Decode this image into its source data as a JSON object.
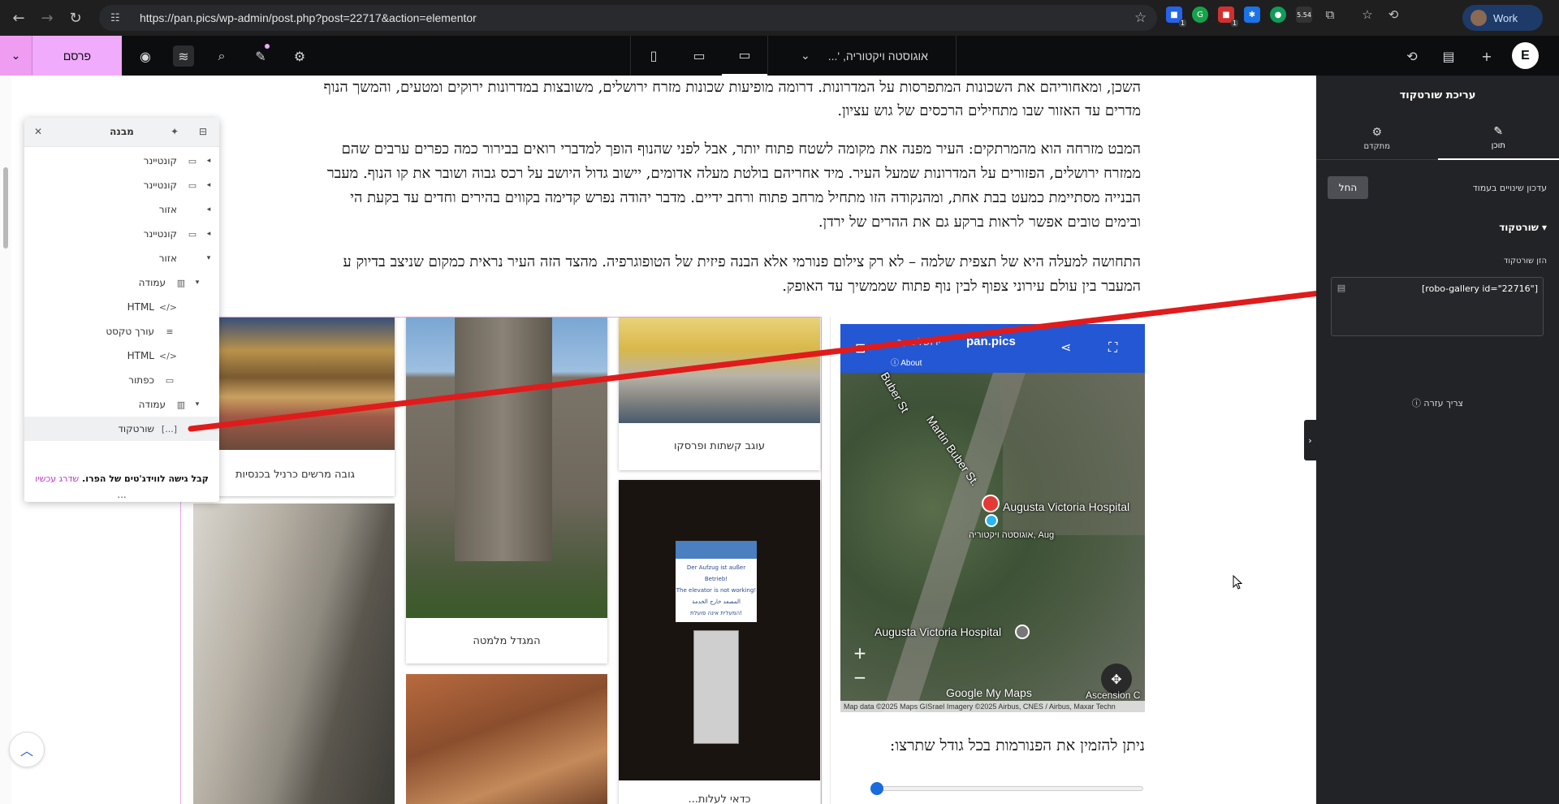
{
  "browser": {
    "url": "https://pan.pics/wp-admin/post.php?post=22717&action=elementor",
    "profile_label": "Work",
    "ext_badge_count": "5.54"
  },
  "topbar": {
    "publish_label": "פרסם",
    "document_title": "אוגוסטה ויקטוריה, '..."
  },
  "content": {
    "paragraphs": [
      "השכן, ומאחוריהם את השכונות המתפרסות על המדרונות. דרומה מופיעות שכונות מזרח ירושלים, משובצות במדרונות ירוקים ומטעים, והמשך הנוף",
      "מדרים עד האזור שבו מתחילים הרכסים של גוש עציון.",
      "המבט מזרחה הוא מהמרתקים: העיר מפנה את מקומה לשטח פתוח יותר, אבל לפני שהנוף הופך למדברי רואים בבירור כמה כפרים ערבים שהם",
      "ממזרח ירושלים, הפזורים על המדרונות שמעל העיר. מיד אחריהם בולטת מעלה אדומים, יישוב גדול היושב על רכס גבוה ושובר את קו הנוף. מעבר",
      "הבנייה מסתיימת כמעט בבת אחת, ומהנקודה הזו מתחיל מרחב פתוח ורחב ידיים. מדבר יהודה נפרש קדימה בקווים בהירים וחדים עד בקעת הי",
      "ובימים טובים אפשר לראות ברקע גם את ההרים של ירדן.",
      "התחושה למעלה היא של תצפית שלמה – לא רק צילום פנורמי אלא הבנה פיזית של הטופוגרפיה. מהצד הזה העיר נראית כמקום שניצב בדיוק ע",
      "המעבר בין עולם עירוני צפוף לבין נוף פתוח שממשיך עד האופק."
    ],
    "gallery_captions": [
      "גובה מרשים כרניל בכנסיות",
      "המגדל מלמטה",
      "עוגב קשתות ופרסקו",
      "כדאי לעלות..."
    ],
    "elevator_sign": {
      "german": "Der Aufzug ist außer Betrieb!",
      "english": "The elevator is not working!",
      "arabic": "المصعد خارج الخدمة",
      "hebrew": "המעלית אינה פועלת!"
    },
    "map": {
      "place_name": "pan.pics",
      "header_prefix": "ירושלים ,ב",
      "about_label": "About",
      "street_labels": [
        "Buber St",
        "Martin Buber St."
      ],
      "poi_hospital_label": "Augusta Victoria Hospital",
      "poi_hebrew_label": "אוגוסטה ויקטוריה, Aug",
      "poi_hospital_label_2": "Augusta Victoria Hospital",
      "poi_ascension": "Ascension C",
      "google_label": "Google My Maps",
      "attribution": "Map data ©2025 Maps GISrael Imagery ©2025 Airbus, CNES / Airbus, Maxar Techn",
      "zoom_in": "+",
      "zoom_out": "−"
    },
    "order_text": "ניתן להזמין את הפנורמות בכל גודל שתרצו:",
    "slider_position": 0
  },
  "navigator": {
    "title": "מבנה",
    "items": [
      {
        "label": "קונטיינר",
        "icon": "container-icon"
      },
      {
        "label": "קונטיינר",
        "icon": "container-icon"
      },
      {
        "label": "אזור",
        "icon": "section-icon"
      },
      {
        "label": "קונטיינר",
        "icon": "container-icon"
      },
      {
        "label": "אזור",
        "icon": "section-icon"
      },
      {
        "label": "עמודה",
        "icon": "column-icon"
      },
      {
        "label": "HTML",
        "icon": "html-icon"
      },
      {
        "label": "עורך טקסט",
        "icon": "text-editor-icon"
      },
      {
        "label": "HTML",
        "icon": "html-icon"
      },
      {
        "label": "כפתור",
        "icon": "button-widget-icon"
      },
      {
        "label": "עמודה",
        "icon": "column-icon"
      },
      {
        "label": "שורטקוד",
        "icon": "shortcode-icon"
      }
    ],
    "footer_text": "קבל גישה לווידג'טים של הפרו.",
    "footer_link": "שדרג עכשיו",
    "more": "..."
  },
  "panel": {
    "title": "עריכת שורטקוד",
    "tab_content": "תוכן",
    "tab_advanced": "מתקדם",
    "live_update_label": "עדכון שינויים בעמוד",
    "apply_label": "החל",
    "section_title": "שורטקוד",
    "field_label": "הזן שורטקוד",
    "shortcode_value": "[robo-gallery id=\"22716\"]",
    "help_label": "צריך עזרה"
  },
  "colors": {
    "publish_bg": "#f0abfc",
    "topbar_bg": "#0c0d0e",
    "panel_bg": "#222326",
    "annotation_arrow": "#e01b1b",
    "map_header": "#2457d4"
  }
}
